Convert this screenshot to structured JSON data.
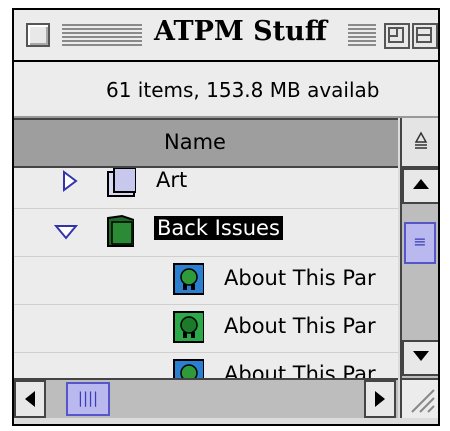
{
  "window": {
    "title": "ATPM Stuff",
    "status": "61 items, 153.8 MB availab"
  },
  "column_header": {
    "name_label": "Name",
    "sort_icon": "sort-direction-icon"
  },
  "rows": [
    {
      "label": "Art",
      "icon": "folder-icon",
      "expanded": false
    },
    {
      "label": "Back Issues",
      "icon": "folder-icon",
      "expanded": true,
      "selected": true
    },
    {
      "label": "About This Par",
      "icon": "document-icon"
    },
    {
      "label": "About This Par",
      "icon": "document-icon"
    },
    {
      "label": "About This Par",
      "icon": "document-icon"
    }
  ],
  "colors": {
    "selection": "#000000",
    "scroll_thumb": "#b9b9f0",
    "folder_green": "#1f6a2a"
  }
}
